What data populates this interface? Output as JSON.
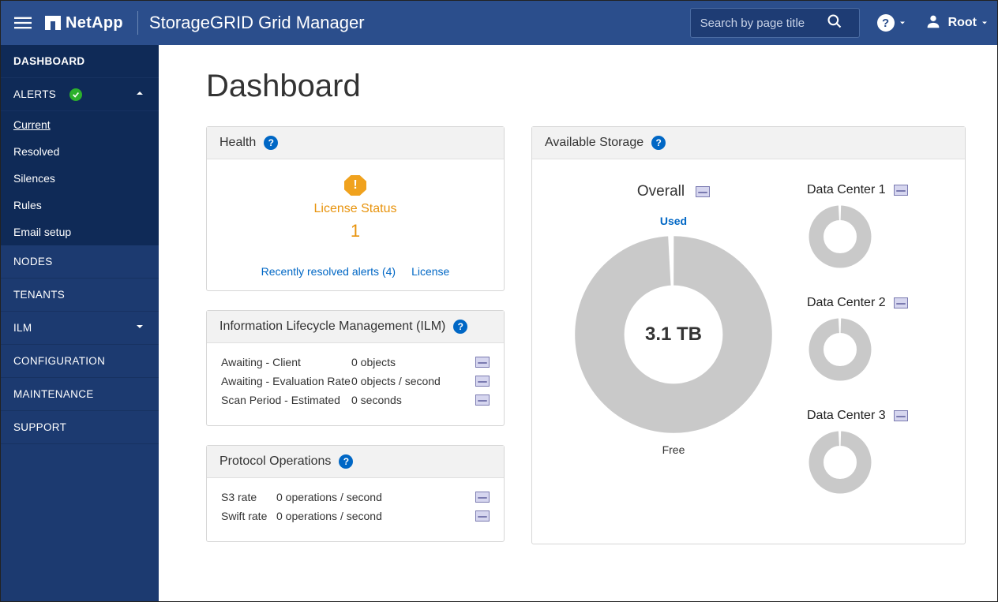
{
  "header": {
    "brand": "NetApp",
    "app_title": "StorageGRID Grid Manager",
    "search_placeholder": "Search by page title",
    "user": "Root"
  },
  "sidebar": {
    "dashboard": "DASHBOARD",
    "alerts": "ALERTS",
    "alerts_sub": {
      "current": "Current",
      "resolved": "Resolved",
      "silences": "Silences",
      "rules": "Rules",
      "email": "Email setup"
    },
    "nodes": "NODES",
    "tenants": "TENANTS",
    "ilm": "ILM",
    "configuration": "CONFIGURATION",
    "maintenance": "MAINTENANCE",
    "support": "SUPPORT"
  },
  "page": {
    "title": "Dashboard"
  },
  "health": {
    "title": "Health",
    "license_label": "License Status",
    "license_count": "1",
    "link_resolved": "Recently resolved alerts (4)",
    "link_license": "License"
  },
  "ilm": {
    "title": "Information Lifecycle Management (ILM)",
    "r1k": "Awaiting - Client",
    "r1v": "0 objects",
    "r2k": "Awaiting - Evaluation Rate",
    "r2v": "0 objects / second",
    "r3k": "Scan Period - Estimated",
    "r3v": "0 seconds"
  },
  "proto": {
    "title": "Protocol Operations",
    "r1k": "S3 rate",
    "r1v": "0 operations / second",
    "r2k": "Swift rate",
    "r2v": "0 operations / second"
  },
  "storage": {
    "title": "Available Storage",
    "overall": "Overall",
    "used": "Used",
    "total": "3.1 TB",
    "free": "Free",
    "dc1": "Data Center 1",
    "dc2": "Data Center 2",
    "dc3": "Data Center 3"
  },
  "chart_data": {
    "type": "pie",
    "title": "Available Storage — Overall",
    "total_label": "3.1 TB",
    "series": [
      {
        "name": "Used",
        "fraction": 0.01
      },
      {
        "name": "Free",
        "fraction": 0.99
      }
    ],
    "data_centers": [
      {
        "name": "Data Center 1",
        "used_fraction": 0.01,
        "free_fraction": 0.99
      },
      {
        "name": "Data Center 2",
        "used_fraction": 0.01,
        "free_fraction": 0.99
      },
      {
        "name": "Data Center 3",
        "used_fraction": 0.01,
        "free_fraction": 0.99
      }
    ]
  }
}
